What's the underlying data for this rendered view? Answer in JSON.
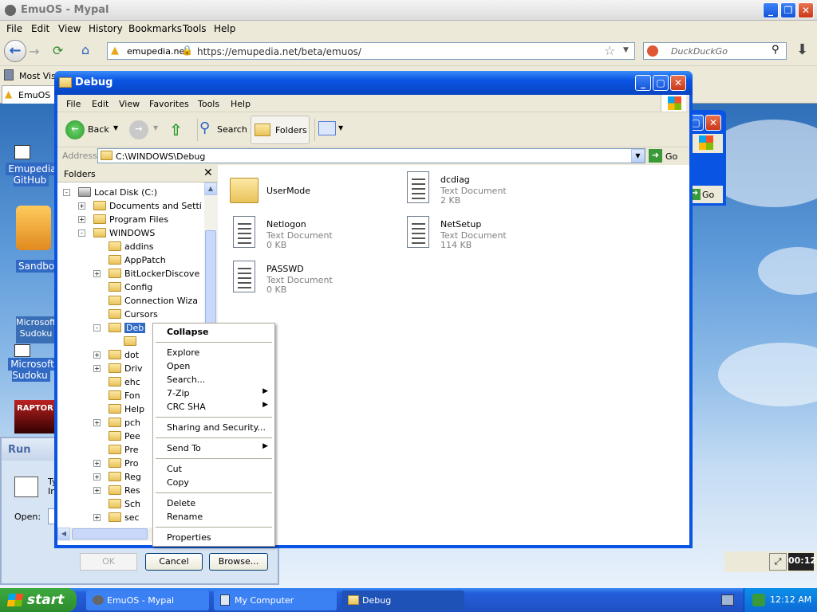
{
  "browser": {
    "title": "EmuOS - Mypal",
    "menu": [
      "File",
      "Edit",
      "View",
      "History",
      "Bookmarks",
      "Tools",
      "Help"
    ],
    "site_badge": "emupedia.net",
    "url": "https://emupedia.net/beta/emuos/",
    "search_placeholder": "DuckDuckGo",
    "bookmark": "Most Visit",
    "tab_label": "EmuOS"
  },
  "desktop": {
    "icons": [
      "Emupedia GitHub",
      "Sandbox",
      "Microsoft Sudoku",
      "Microsoft Sudoku",
      "RAPTOR"
    ]
  },
  "explorer": {
    "title": "Debug",
    "menu": [
      "File",
      "Edit",
      "View",
      "Favorites",
      "Tools",
      "Help"
    ],
    "toolbar": {
      "back": "Back",
      "search": "Search",
      "folders": "Folders"
    },
    "address_label": "Address",
    "address_value": "C:\\WINDOWS\\Debug",
    "go_label": "Go",
    "folders_title": "Folders",
    "tree": [
      {
        "label": "Local Disk (C:)",
        "indent": 0,
        "expander": "-"
      },
      {
        "label": "Documents and Setti",
        "indent": 1,
        "expander": "+"
      },
      {
        "label": "Program Files",
        "indent": 1,
        "expander": "+"
      },
      {
        "label": "WINDOWS",
        "indent": 1,
        "expander": "-"
      },
      {
        "label": "addins",
        "indent": 2,
        "expander": ""
      },
      {
        "label": "AppPatch",
        "indent": 2,
        "expander": ""
      },
      {
        "label": "BitLockerDiscove",
        "indent": 2,
        "expander": "+"
      },
      {
        "label": "Config",
        "indent": 2,
        "expander": ""
      },
      {
        "label": "Connection Wiza",
        "indent": 2,
        "expander": ""
      },
      {
        "label": "Cursors",
        "indent": 2,
        "expander": ""
      },
      {
        "label": "Deb",
        "indent": 2,
        "expander": "-",
        "selected": true
      },
      {
        "label": "",
        "indent": 3,
        "expander": ""
      },
      {
        "label": "dot",
        "indent": 2,
        "expander": "+"
      },
      {
        "label": "Driv",
        "indent": 2,
        "expander": "+"
      },
      {
        "label": "ehc",
        "indent": 2,
        "expander": ""
      },
      {
        "label": "Fon",
        "indent": 2,
        "expander": ""
      },
      {
        "label": "Help",
        "indent": 2,
        "expander": ""
      },
      {
        "label": "pch",
        "indent": 2,
        "expander": "+"
      },
      {
        "label": "Pee",
        "indent": 2,
        "expander": ""
      },
      {
        "label": "Pre",
        "indent": 2,
        "expander": ""
      },
      {
        "label": "Pro",
        "indent": 2,
        "expander": "+"
      },
      {
        "label": "Reg",
        "indent": 2,
        "expander": "+"
      },
      {
        "label": "Res",
        "indent": 2,
        "expander": "+"
      },
      {
        "label": "Sch",
        "indent": 2,
        "expander": ""
      },
      {
        "label": "sec",
        "indent": 2,
        "expander": "+"
      }
    ],
    "files": [
      {
        "name": "UserMode",
        "type": "",
        "size": "",
        "kind": "folder"
      },
      {
        "name": "dcdiag",
        "type": "Text Document",
        "size": "2 KB",
        "kind": "doc"
      },
      {
        "name": "Netlogon",
        "type": "Text Document",
        "size": "0 KB",
        "kind": "doc"
      },
      {
        "name": "NetSetup",
        "type": "Text Document",
        "size": "114 KB",
        "kind": "doc"
      },
      {
        "name": "PASSWD",
        "type": "Text Document",
        "size": "0 KB",
        "kind": "doc"
      }
    ]
  },
  "context_menu": {
    "items": [
      {
        "label": "Collapse",
        "bold": true
      },
      {
        "sep": true
      },
      {
        "label": "Explore"
      },
      {
        "label": "Open"
      },
      {
        "label": "Search..."
      },
      {
        "label": "7-Zip",
        "submenu": true
      },
      {
        "label": "CRC SHA",
        "submenu": true
      },
      {
        "sep": true
      },
      {
        "label": "Sharing and Security..."
      },
      {
        "sep": true
      },
      {
        "label": "Send To",
        "submenu": true
      },
      {
        "sep": true
      },
      {
        "label": "Cut"
      },
      {
        "label": "Copy"
      },
      {
        "sep": true
      },
      {
        "label": "Delete"
      },
      {
        "label": "Rename"
      },
      {
        "sep": true
      },
      {
        "label": "Properties"
      }
    ]
  },
  "run_dialog": {
    "title": "Run",
    "text_a": "Ty",
    "text_b": "In",
    "open_label": "Open:",
    "ok": "OK",
    "cancel": "Cancel",
    "browse": "Browse..."
  },
  "back_window": {
    "go_label": "Go"
  },
  "taskbar": {
    "start": "start",
    "tasks": [
      {
        "label": "EmuOS - Mypal",
        "active": false
      },
      {
        "label": "My Computer",
        "active": false
      },
      {
        "label": "Debug",
        "active": true
      }
    ],
    "clock": "12:12 AM",
    "inner_clock": "00:12"
  },
  "colors": {
    "xp_blue": "#0a54e3",
    "selection": "#316ac5",
    "start_green": "#3eaa3e"
  }
}
